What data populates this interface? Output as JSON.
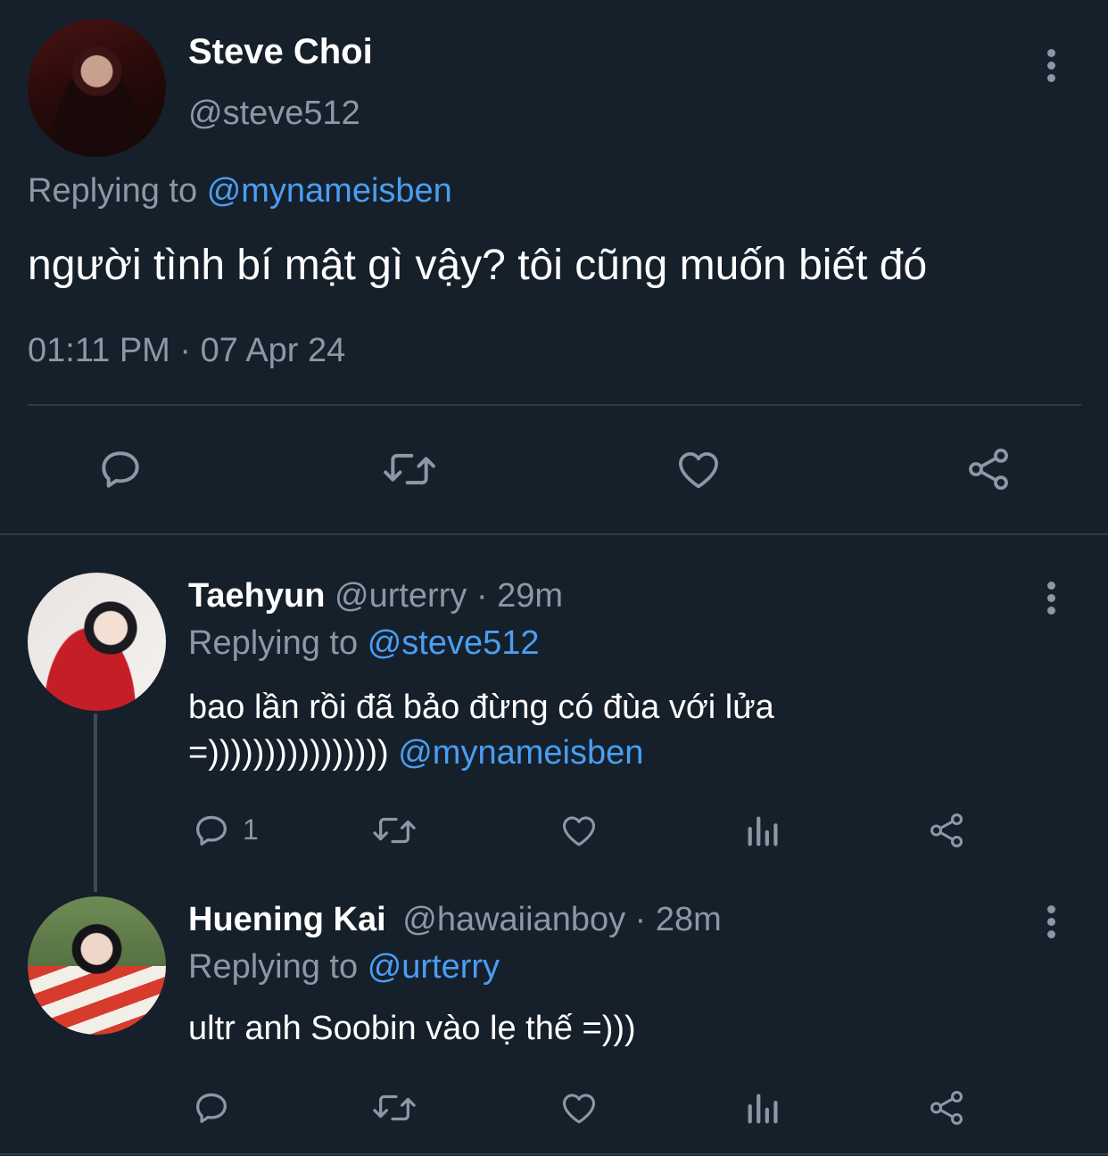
{
  "main_tweet": {
    "display_name": "Steve Choi",
    "handle": "@steve512",
    "replying_prefix": "Replying to",
    "replying_to": "@mynameisben",
    "text": "người tình bí mật gì vậy? tôi cũng muốn biết đó",
    "timestamp": "01:11 PM · 07 Apr 24",
    "actions": [
      "reply-icon",
      "retweet-icon",
      "like-icon",
      "share-icon"
    ]
  },
  "replies": [
    {
      "display_name": "Taehyun",
      "handle": "@urterry",
      "time": "· 29m",
      "replying_prefix": "Replying to",
      "replying_to": "@steve512",
      "text_line1": "bao lần rồi đã bảo đừng có đùa với lửa",
      "text_line2": "=))))))))))))))))",
      "text_mention": "@mynameisben",
      "reply_count": "1"
    },
    {
      "display_name": "Huening Kai",
      "handle": "@hawaiianboy",
      "time": "· 28m",
      "replying_prefix": "Replying to",
      "replying_to": "@urterry",
      "text_line1": "ultr anh Soobin vào lẹ thế =)))"
    }
  ],
  "colors": {
    "background": "#16202b",
    "accent": "#4a9ef2",
    "muted": "#8b98a5",
    "divider": "#2f3b47"
  }
}
